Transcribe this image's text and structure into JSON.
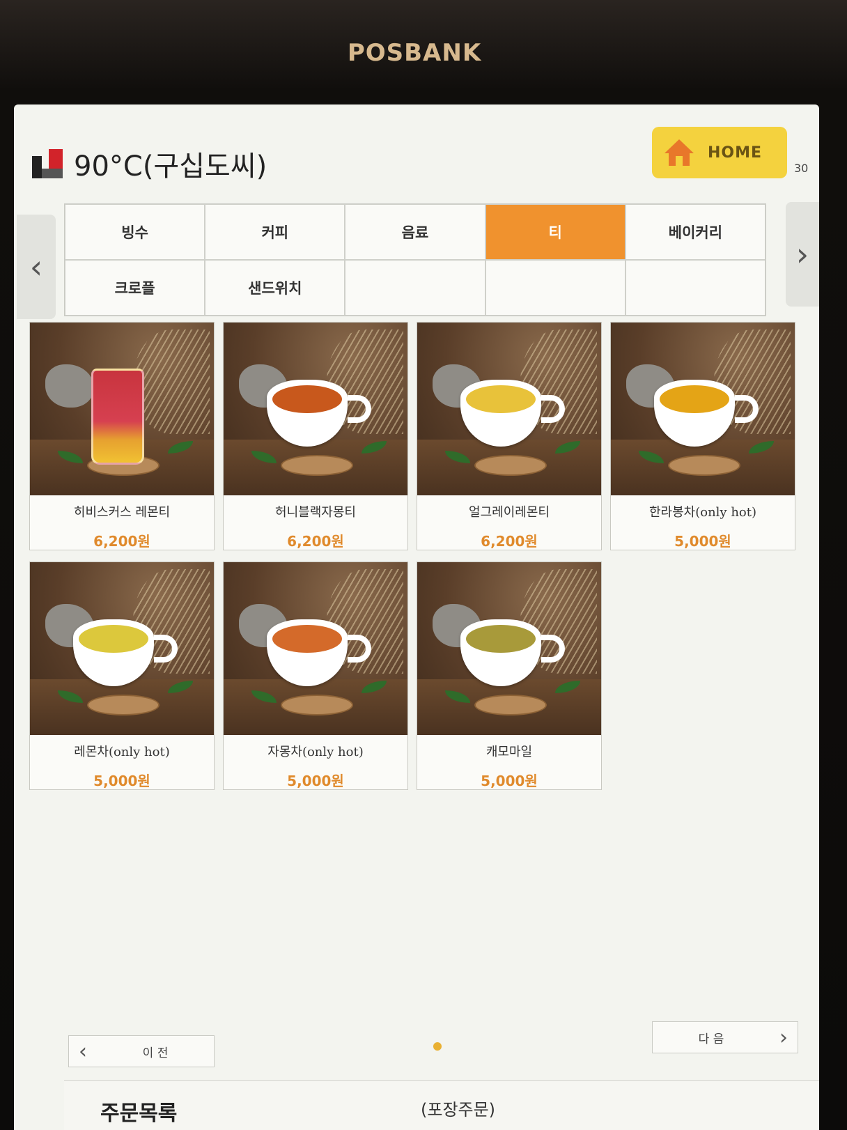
{
  "device": {
    "brand": "POSBANK"
  },
  "header": {
    "store_name": "90°C(구십도씨)",
    "home_label": "HOME",
    "timer": "30"
  },
  "categories": [
    {
      "label": "빙수",
      "active": false
    },
    {
      "label": "커피",
      "active": false
    },
    {
      "label": "음료",
      "active": false
    },
    {
      "label": "티",
      "active": true
    },
    {
      "label": "베이커리",
      "active": false
    },
    {
      "label": "크로플",
      "active": false
    },
    {
      "label": "샌드위치",
      "active": false
    },
    {
      "label": "",
      "active": false
    },
    {
      "label": "",
      "active": false
    },
    {
      "label": "",
      "active": false
    }
  ],
  "products": [
    {
      "name": "히비스커스 레몬티",
      "price": "6,200원",
      "tea_color": "#c8343e"
    },
    {
      "name": "허니블랙자몽티",
      "price": "6,200원",
      "tea_color": "#c8581c"
    },
    {
      "name": "얼그레이레몬티",
      "price": "6,200원",
      "tea_color": "#e8c23a"
    },
    {
      "name": "한라봉차(only hot)",
      "price": "5,000원",
      "tea_color": "#e4a416"
    },
    {
      "name": "레몬차(only hot)",
      "price": "5,000원",
      "tea_color": "#dcc83c"
    },
    {
      "name": "자몽차(only hot)",
      "price": "5,000원",
      "tea_color": "#d46a2a"
    },
    {
      "name": "캐모마일",
      "price": "5,000원",
      "tea_color": "#a89a3a"
    }
  ],
  "pagination": {
    "prev_label": "이 전",
    "next_label": "다 음"
  },
  "order": {
    "title": "주문목록",
    "type": "(포장주문)"
  },
  "colors": {
    "accent": "#f0922e",
    "home": "#f4d23e",
    "price": "#e08a2c"
  }
}
